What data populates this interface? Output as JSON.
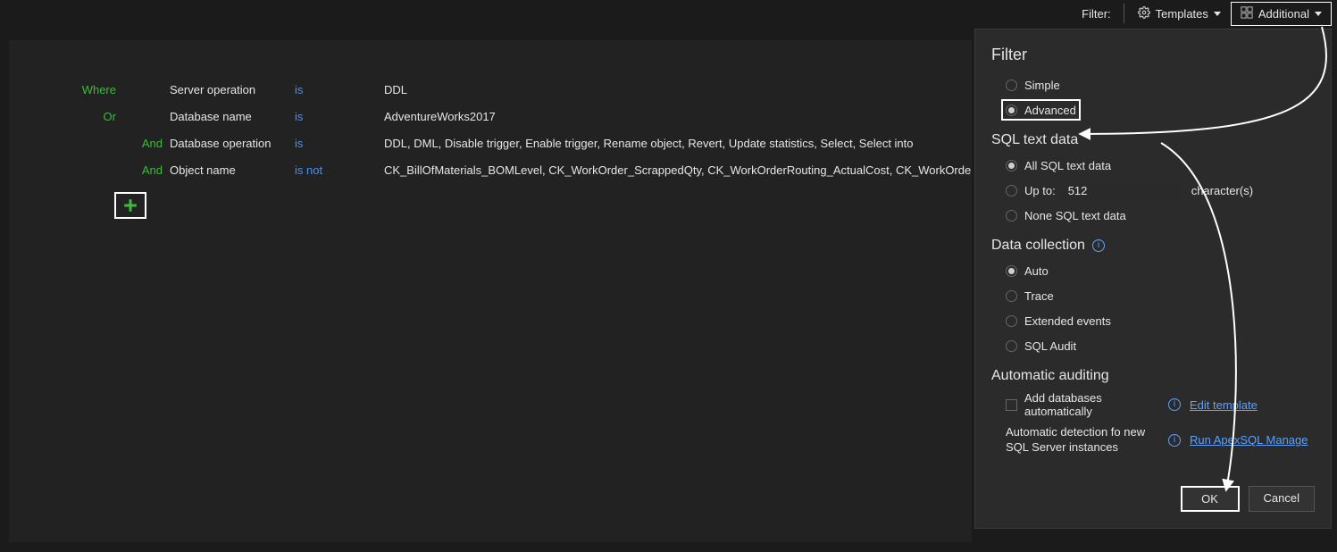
{
  "toolbar": {
    "filter_label": "Filter:",
    "templates_label": "Templates",
    "additional_label": "Additional"
  },
  "rules": [
    {
      "op": "Where",
      "field": "Server operation",
      "cond": "is",
      "val": "DDL"
    },
    {
      "op": "Or",
      "field": "Database name",
      "cond": "is",
      "val": "AdventureWorks2017"
    },
    {
      "op": "And",
      "field": "Database operation",
      "cond": "is",
      "val": "DDL, DML, Disable trigger, Enable trigger, Rename object, Revert, Update statistics, Select, Select into",
      "indent": true
    },
    {
      "op": "And",
      "field": "Object name",
      "cond": "is not",
      "val": "CK_BillOfMaterials_BOMLevel, CK_WorkOrder_ScrappedQty, CK_WorkOrderRouting_ActualCost, CK_WorkOrderRouti",
      "indent": true
    }
  ],
  "panel": {
    "filter": {
      "title": "Filter",
      "simple": "Simple",
      "advanced": "Advanced"
    },
    "sqltext": {
      "title": "SQL text data",
      "all": "All SQL text data",
      "upto": "Up to:",
      "upto_value": "512",
      "chars": "character(s)",
      "none": "None SQL text data"
    },
    "datacol": {
      "title": "Data collection",
      "auto": "Auto",
      "trace": "Trace",
      "ext": "Extended events",
      "audit": "SQL Audit"
    },
    "autoaudit": {
      "title": "Automatic auditing",
      "add_auto": "Add databases automatically",
      "edit_template": "Edit template",
      "desc": "Automatic detection fo new SQL Server instances",
      "run": "Run ApexSQL Manage"
    },
    "ok": "OK",
    "cancel": "Cancel"
  }
}
